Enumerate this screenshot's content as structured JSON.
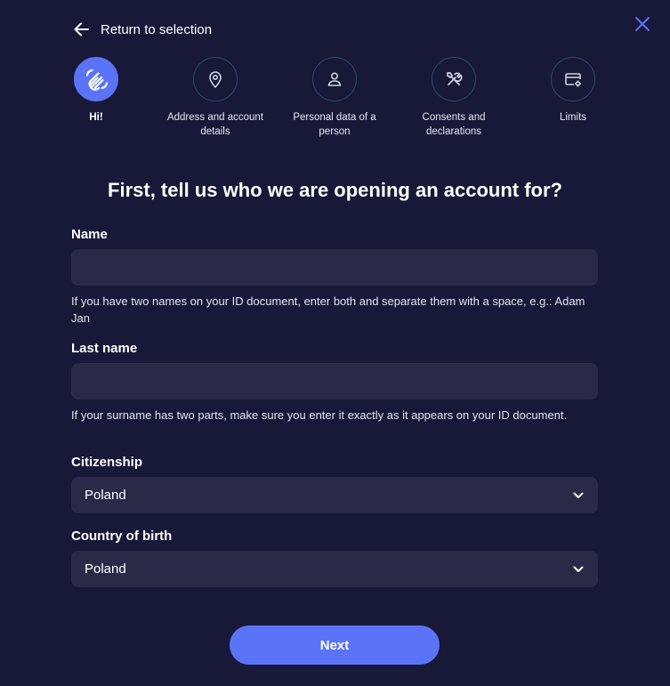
{
  "header": {
    "back_label": "Return to selection",
    "back_icon": "arrow-left-icon",
    "close_icon": "close-icon"
  },
  "steps": [
    {
      "label": "Hi!",
      "icon": "waving-hand-icon",
      "active": true
    },
    {
      "label": "Address and account details",
      "icon": "location-pin-icon",
      "active": false
    },
    {
      "label": "Personal data of a person",
      "icon": "person-icon",
      "active": false
    },
    {
      "label": "Consents and declarations",
      "icon": "tools-icon",
      "active": false
    },
    {
      "label": "Limits",
      "icon": "card-settings-icon",
      "active": false
    }
  ],
  "form": {
    "heading": "First, tell us who we are opening an account for?",
    "name": {
      "label": "Name",
      "value": "",
      "hint": "If you have two names on your ID document, enter both and separate them with a space, e.g.: Adam Jan"
    },
    "last_name": {
      "label": "Last name",
      "value": "",
      "hint": "If your surname has two parts, make sure you enter it exactly as it appears on your ID document."
    },
    "citizenship": {
      "label": "Citizenship",
      "value": "Poland"
    },
    "country_of_birth": {
      "label": "Country of birth",
      "value": "Poland"
    },
    "next_label": "Next"
  },
  "colors": {
    "background": "#181838",
    "accent": "#5b74f7",
    "field_background": "#2a2a48",
    "step_border": "#2a4d6e"
  }
}
